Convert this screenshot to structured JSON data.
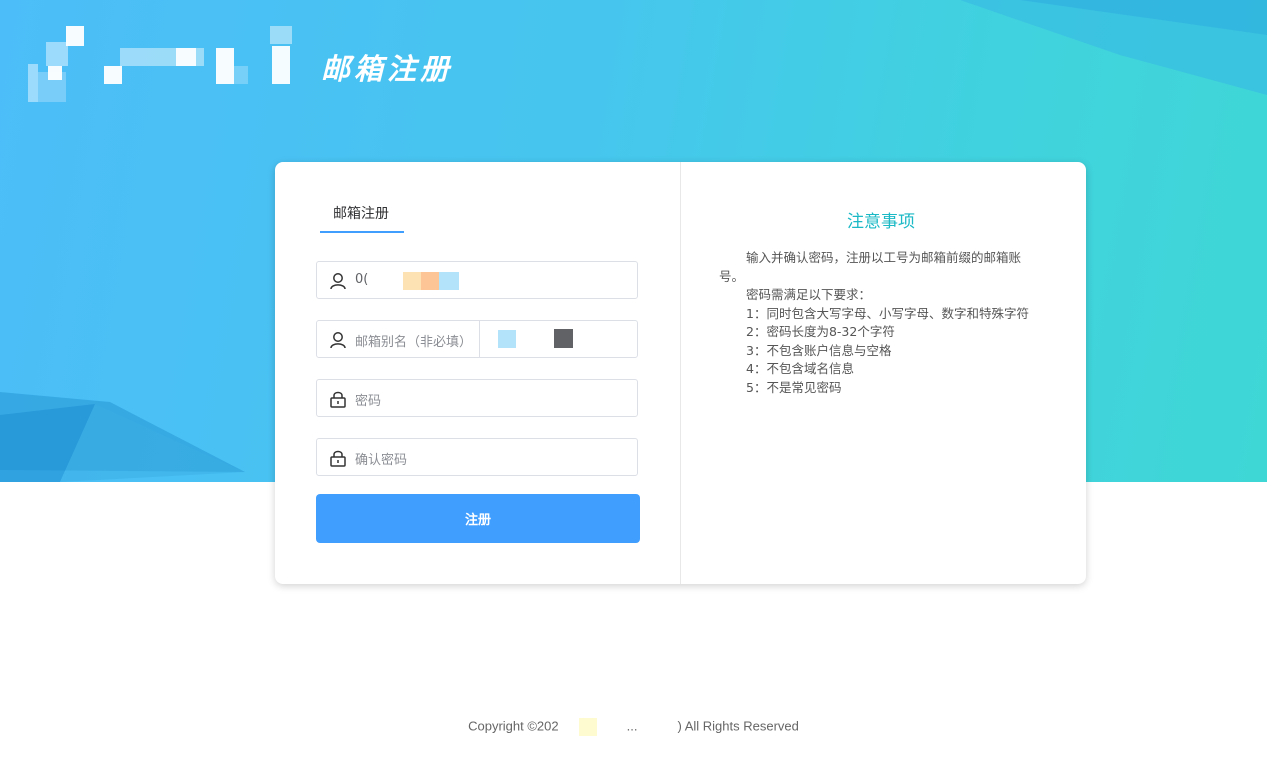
{
  "header": {
    "title": "邮箱注册",
    "colors": {
      "brand_gradient_start": "#4cbdf8",
      "brand_gradient_end": "#3fd7d6"
    }
  },
  "form": {
    "tab_label": "邮箱注册",
    "username": {
      "value": "0(",
      "icon": "user-icon"
    },
    "alias": {
      "placeholder": "邮箱别名（非必填）",
      "icon": "user-icon"
    },
    "password": {
      "placeholder": "密码",
      "icon": "lock-icon"
    },
    "confirm_password": {
      "placeholder": "确认密码",
      "icon": "lock-icon"
    },
    "submit_label": "注册",
    "accent_color": "#409eff"
  },
  "notes": {
    "title": "注意事项",
    "intro": "输入并确认密码，注册以工号为邮箱前缀的邮箱账号。",
    "requirements_title": "密码需满足以下要求：",
    "items": [
      "1：同时包含大写字母、小写字母、数字和特殊字符",
      "2：密码长度为8-32个字符",
      "3：不包含账户信息与空格",
      "4：不包含域名信息",
      "5：不是常见密码"
    ]
  },
  "footer": {
    "copyright_prefix": "Copyright ©202",
    "ellipsis": "...",
    "copyright_suffix": ") All Rights Reserved"
  }
}
